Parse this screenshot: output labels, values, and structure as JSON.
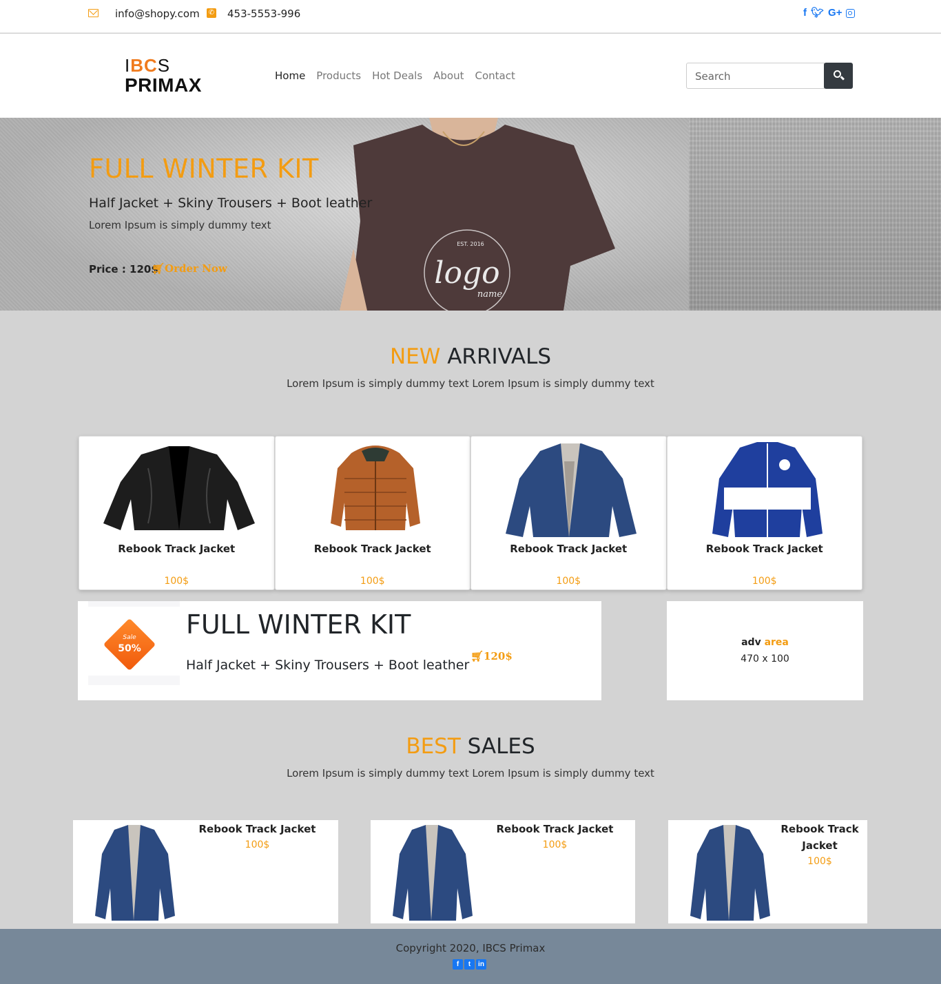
{
  "topbar": {
    "email": "info@shopy.com",
    "phone": "453-5553-996",
    "social_icons": [
      "facebook-icon",
      "twitter-icon",
      "google-plus-icon",
      "instagram-icon"
    ]
  },
  "header": {
    "logo_line1_a": "I",
    "logo_line1_b": "BC",
    "logo_line1_c": "S",
    "logo_line2": "PRIMAX",
    "nav": [
      "Home",
      "Products",
      "Hot Deals",
      "About",
      "Contact"
    ],
    "active_nav": "Home",
    "search_placeholder": "Search"
  },
  "hero": {
    "title": "FULL WINTER KIT",
    "subtitle": "Half Jacket + Skiny Trousers + Boot leather",
    "description": "Lorem Ipsum is simply dummy text",
    "price": "Price : 120$",
    "order_label": "Order Now"
  },
  "new_arrivals": {
    "title_highlight": "NEW",
    "title_rest": " ARRIVALS",
    "description": "Lorem Ipsum is simply dummy text Lorem Ipsum is simply dummy text",
    "products": [
      {
        "name": "Rebook Track Jacket",
        "price": "100$"
      },
      {
        "name": "Rebook Track Jacket",
        "price": "100$"
      },
      {
        "name": "Rebook Track Jacket",
        "price": "100$"
      },
      {
        "name": "Rebook Track Jacket",
        "price": "100$"
      }
    ]
  },
  "promo": {
    "badge_sale": "Sale",
    "badge_percent": "50%",
    "title": "FULL WINTER KIT",
    "subtitle": "Half Jacket + Skiny Trousers + Boot leather",
    "price": "120$"
  },
  "adv": {
    "label_a": "adv ",
    "label_b": "area",
    "size": "470 x 100"
  },
  "best_sales": {
    "title_highlight": "BEST",
    "title_rest": " SALES",
    "description": "Lorem Ipsum is simply dummy text Lorem Ipsum is simply dummy text",
    "products": [
      {
        "name": "Rebook Track Jacket",
        "price": "100$"
      },
      {
        "name": "Rebook Track Jacket",
        "price": "100$"
      },
      {
        "name_line1": "Rebook Track",
        "name_line2": "Jacket",
        "price": "100$"
      }
    ]
  },
  "footer": {
    "copyright": "Copyright 2020, IBCS Primax",
    "icons": [
      "facebook-icon",
      "twitter-icon",
      "linkedin-icon"
    ]
  },
  "colors": {
    "accent": "#f39c12",
    "background": "#d3d3d3",
    "footer": "#778899",
    "search_button": "#343a40"
  }
}
